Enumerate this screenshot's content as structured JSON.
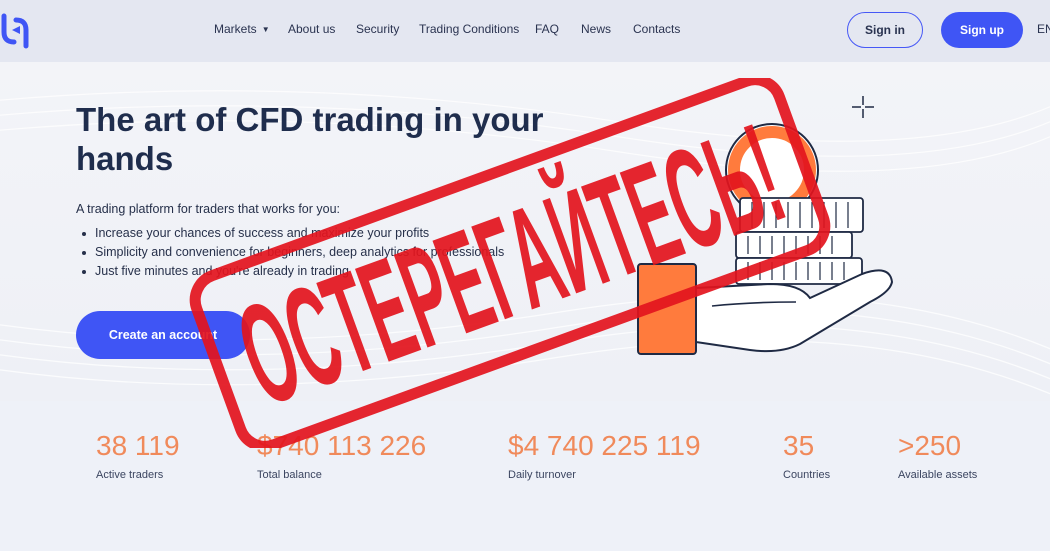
{
  "header": {
    "nav": [
      {
        "label": "Markets",
        "has_dropdown": true
      },
      {
        "label": "About us"
      },
      {
        "label": "Security"
      },
      {
        "label": "Trading Conditions"
      },
      {
        "label": "FAQ"
      },
      {
        "label": "News"
      },
      {
        "label": "Contacts"
      }
    ],
    "caret": "▼",
    "sign_in": "Sign in",
    "sign_up": "Sign up",
    "language": "EN"
  },
  "hero": {
    "title": "The art of CFD trading in your hands",
    "subtitle": "A trading platform for traders that works for you:",
    "bullets": [
      "Increase your chances of success and maximize your profits",
      "Simplicity and convenience for beginners, deep analytics for professionals",
      "Just five minutes and you're already in trading"
    ],
    "cta": "Create an account"
  },
  "stats": [
    {
      "value": "38 119",
      "label": "Active traders"
    },
    {
      "value": "$740 113 226",
      "label": "Total balance"
    },
    {
      "value": "$4 740 225 119",
      "label": "Daily turnover"
    },
    {
      "value": "35",
      "label": "Countries"
    },
    {
      "value": ">250",
      "label": "Available assets"
    }
  ],
  "overlay": {
    "stamp_text": "ОСТЕРЕГАЙТЕСЬ!"
  },
  "colors": {
    "accent": "#3f55f5",
    "stat_value": "#f08a5b",
    "stamp": "#e3141d",
    "illustration_orange": "#ff7b3d"
  }
}
